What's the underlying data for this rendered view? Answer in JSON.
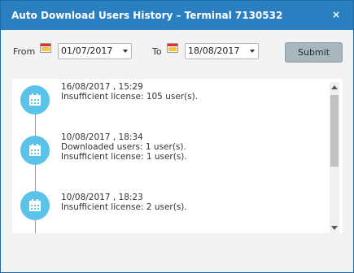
{
  "dialog": {
    "title": "Auto Download Users History – Terminal 7130532",
    "close_label": "×"
  },
  "filters": {
    "from_label": "From",
    "from_value": "01/07/2017",
    "to_label": "To",
    "to_value": "18/08/2017",
    "submit_label": "Submit"
  },
  "history": [
    {
      "timestamp": "16/08/2017 , 15:29",
      "lines": [
        "Insufficient license: 105 user(s)."
      ]
    },
    {
      "timestamp": "10/08/2017 , 18:34",
      "lines": [
        "Downloaded users: 1 user(s).",
        "Insufficient license: 1 user(s)."
      ]
    },
    {
      "timestamp": "10/08/2017 , 18:23",
      "lines": [
        "Insufficient license: 2 user(s)."
      ]
    }
  ],
  "colors": {
    "titlebar": "#2a7fc1",
    "badge": "#5bc3ea",
    "submit": "#a9b6be"
  }
}
